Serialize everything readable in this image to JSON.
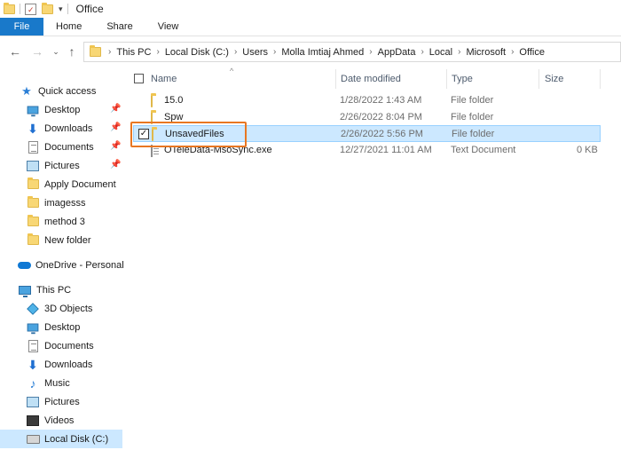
{
  "window": {
    "title": "Office"
  },
  "ribbon": {
    "tabs": [
      "File",
      "Home",
      "Share",
      "View"
    ]
  },
  "address": {
    "breadcrumbs": [
      "This PC",
      "Local Disk (C:)",
      "Users",
      "Molla Imtiaj Ahmed",
      "AppData",
      "Local",
      "Microsoft",
      "Office"
    ]
  },
  "sidebar": {
    "quick_access": "Quick access",
    "quick_items": [
      "Desktop",
      "Downloads",
      "Documents",
      "Pictures",
      "Apply Document",
      "imagesss",
      "method 3",
      "New folder"
    ],
    "onedrive": "OneDrive - Personal",
    "this_pc": "This PC",
    "pc_items": [
      "3D Objects",
      "Desktop",
      "Documents",
      "Downloads",
      "Music",
      "Pictures",
      "Videos",
      "Local Disk (C:)"
    ]
  },
  "columns": {
    "name": "Name",
    "date": "Date modified",
    "type": "Type",
    "size": "Size"
  },
  "files": [
    {
      "name": "15.0",
      "date": "1/28/2022 1:43 AM",
      "type": "File folder",
      "size": "",
      "icon": "folder-icon"
    },
    {
      "name": "Spw",
      "date": "2/26/2022 8:04 PM",
      "type": "File folder",
      "size": "",
      "icon": "folder-icon"
    },
    {
      "name": "UnsavedFiles",
      "date": "2/26/2022 5:56 PM",
      "type": "File folder",
      "size": "",
      "icon": "folder-icon",
      "selected": true
    },
    {
      "name": "OTeleData-MsoSync.exe",
      "date": "12/27/2021 11:01 AM",
      "type": "Text Document",
      "size": "0 KB",
      "icon": "text-file-icon"
    }
  ],
  "colors": {
    "accent": "#1979ca",
    "selection": "#cce8ff",
    "highlight_box": "#e87722",
    "folder": "#f8d775"
  }
}
